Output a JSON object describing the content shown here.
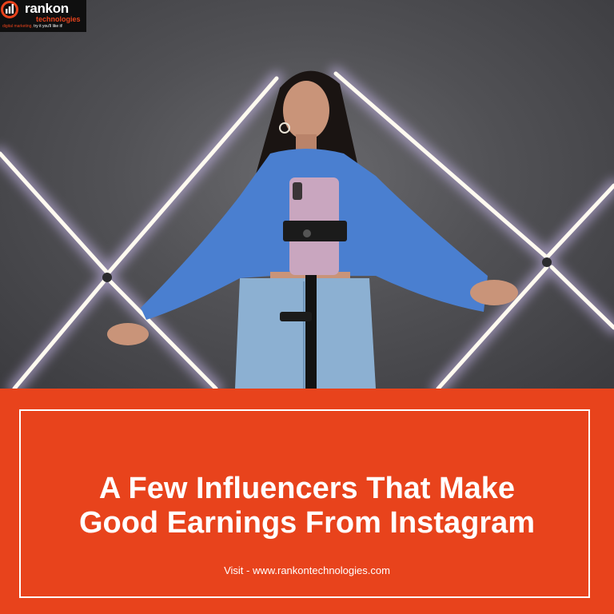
{
  "logo": {
    "name": "rankon",
    "sub": "technologies",
    "tagline_accent": "digital marketing,",
    "tagline_rest": " try it you'll like it!"
  },
  "banner": {
    "headline_line1": "A Few Influencers That Make",
    "headline_line2": "Good Earnings From Instagram",
    "visit_text": "Visit - www.rankontechnologies.com"
  },
  "colors": {
    "brand_orange": "#e8431c",
    "text_white": "#ffffff",
    "sweater_blue": "#4a7fd0",
    "phone_pink": "#c9a6bf"
  },
  "icons": {
    "logo_mark": "bar-chart-ring-icon"
  }
}
